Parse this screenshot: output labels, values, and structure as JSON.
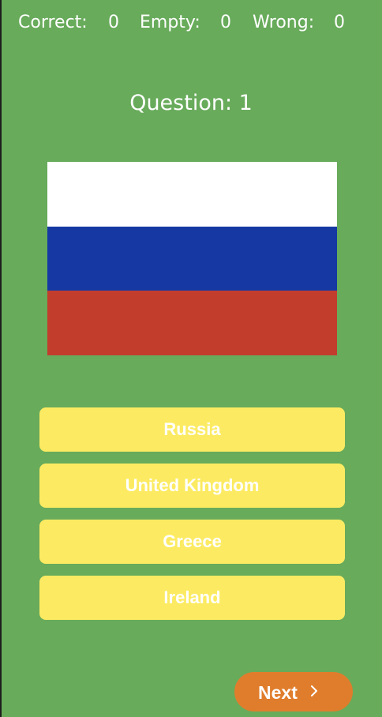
{
  "score": {
    "correct_label": "Correct:",
    "correct_value": "0",
    "empty_label": "Empty:",
    "empty_value": "0",
    "wrong_label": "Wrong:",
    "wrong_value": "0"
  },
  "question": {
    "title": "Question: 1"
  },
  "flag": {
    "stripes": [
      "#ffffff",
      "#1538a3",
      "#c33d2d"
    ]
  },
  "answers": [
    {
      "label": "Russia"
    },
    {
      "label": "United Kingdom"
    },
    {
      "label": "Greece"
    },
    {
      "label": "Ireland"
    }
  ],
  "next_button": {
    "label": "Next",
    "icon": "chevron-right-icon"
  },
  "colors": {
    "background": "#68ab5b",
    "answer_button": "#fceb62",
    "next_button": "#e07d2c",
    "text": "#ffffff"
  }
}
